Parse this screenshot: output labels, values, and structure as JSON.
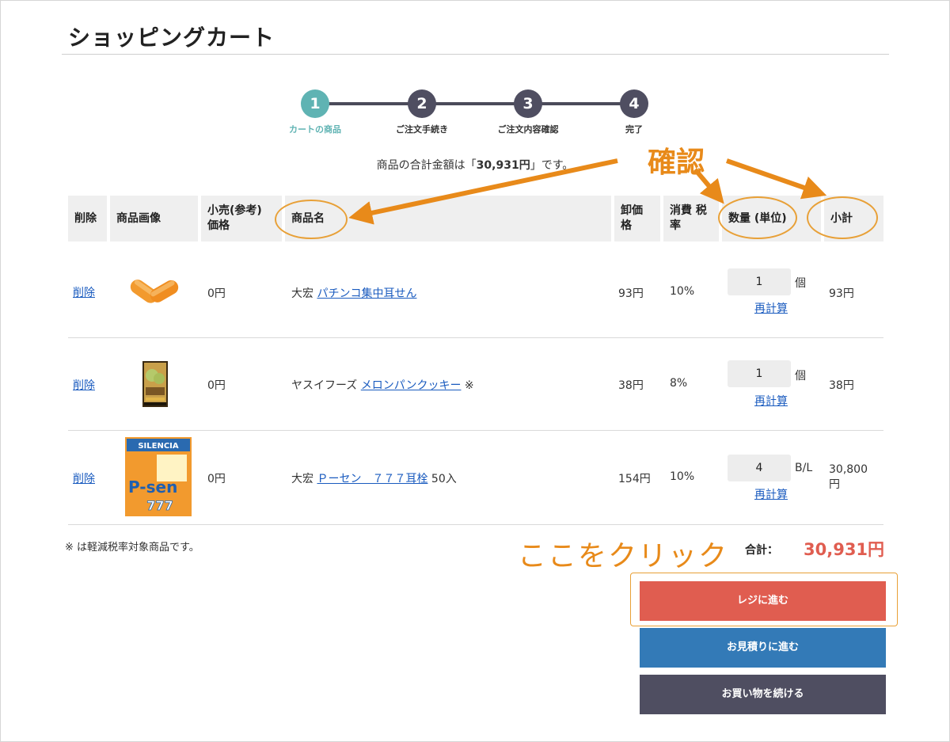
{
  "page": {
    "title": "ショッピングカート"
  },
  "steps": [
    {
      "num": "1",
      "label": "カートの商品"
    },
    {
      "num": "2",
      "label": "ご注文手続き"
    },
    {
      "num": "3",
      "label": "ご注文内容確認"
    },
    {
      "num": "4",
      "label": "完了"
    }
  ],
  "summary": {
    "prefix": "商品の合計金額は「",
    "amount": "30,931円",
    "suffix": "」です。"
  },
  "table": {
    "headers": {
      "delete": "削除",
      "image": "商品画像",
      "retail_line1": "小売(参考)",
      "retail_line2": "価格",
      "name": "商品名",
      "wholesale_line1": "卸価",
      "wholesale_line2": "格",
      "tax_line1": "消費 税",
      "tax_line2": "率",
      "qty": "数量 (単位)",
      "subtotal": "小計"
    },
    "rows": [
      {
        "delete": "削除",
        "image_icon": "orange-earplugs-image",
        "retail": "0円",
        "maker": "大宏",
        "product": "パチンコ集中耳せん",
        "suffix": "",
        "wholesale": "93円",
        "tax": "10%",
        "qty": "1",
        "unit": "個",
        "recalc": "再計算",
        "subtotal": "93円"
      },
      {
        "delete": "削除",
        "image_icon": "melon-pan-cookie-package-image",
        "retail": "0円",
        "maker": "ヤスイフーズ",
        "product": "メロンパンクッキー",
        "suffix": "※",
        "wholesale": "38円",
        "tax": "8%",
        "qty": "1",
        "unit": "個",
        "recalc": "再計算",
        "subtotal": "38円"
      },
      {
        "delete": "削除",
        "image_icon": "p-sen-777-earplug-package-image",
        "retail": "0円",
        "maker": "大宏",
        "product": "Ｐーセン　７７７耳栓",
        "suffix": "50入",
        "wholesale": "154円",
        "tax": "10%",
        "qty": "4",
        "unit": "B/L",
        "recalc": "再計算",
        "subtotal_line1": "30,800",
        "subtotal_line2": "円"
      }
    ]
  },
  "product_image_text": {
    "brand": "SILENCIA",
    "big": "P-sen",
    "num": "777"
  },
  "footnote": "※ は軽減税率対象商品です。",
  "total": {
    "label": "合計：",
    "value": "30,931円"
  },
  "buttons": {
    "checkout": "レジに進む",
    "quote": "お見積りに進む",
    "continue": "お買い物を続ける"
  },
  "annotations": {
    "confirm": "確認",
    "click_here": "ここをクリック"
  },
  "colors": {
    "accent_red": "#e05d50",
    "accent_blue": "#337ab7",
    "dark": "#4f4e61",
    "step_active": "#5fb3b3",
    "annotation_orange": "#e88a1a"
  }
}
